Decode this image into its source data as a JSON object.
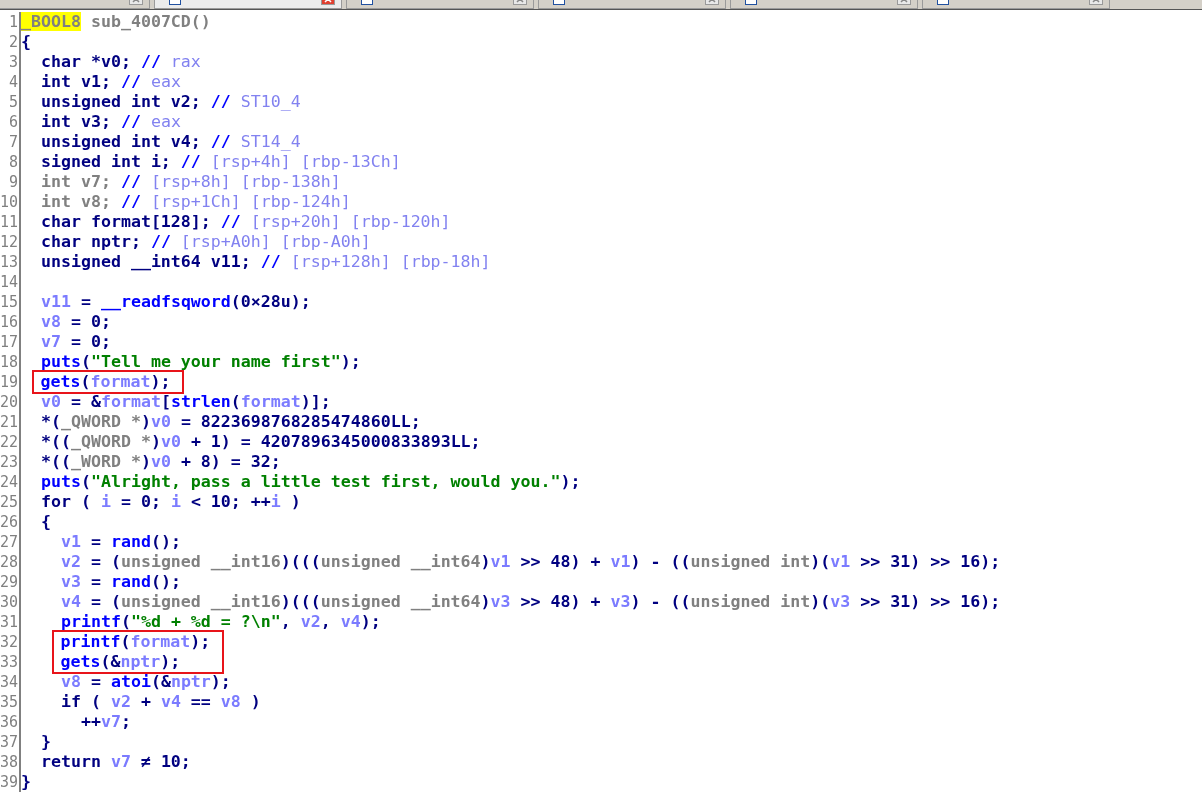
{
  "tabs": [
    {
      "selected": false
    },
    {
      "selected": true
    },
    {
      "selected": false
    },
    {
      "selected": false
    },
    {
      "selected": false
    },
    {
      "selected": false
    }
  ],
  "code": [
    {
      "kind": "line",
      "number": "1",
      "tokens": [
        {
          "kind": "marked",
          "text": "_BOOL8"
        },
        {
          "kind": "muted",
          "text": " sub_4007CD()"
        }
      ]
    },
    {
      "kind": "line",
      "number": "2",
      "tokens": [
        {
          "kind": "plain",
          "text": "{"
        }
      ]
    },
    {
      "kind": "line",
      "number": "3",
      "tokens": [
        {
          "kind": "plain",
          "text": "  char *v0; "
        },
        {
          "kind": "delim",
          "text": "//"
        },
        {
          "kind": "comment",
          "text": " rax"
        }
      ]
    },
    {
      "kind": "line",
      "number": "4",
      "tokens": [
        {
          "kind": "plain",
          "text": "  int v1; "
        },
        {
          "kind": "delim",
          "text": "//"
        },
        {
          "kind": "comment",
          "text": " eax"
        }
      ]
    },
    {
      "kind": "line",
      "number": "5",
      "tokens": [
        {
          "kind": "plain",
          "text": "  unsigned int v2; "
        },
        {
          "kind": "delim",
          "text": "//"
        },
        {
          "kind": "comment",
          "text": " ST10_4"
        }
      ]
    },
    {
      "kind": "line",
      "number": "6",
      "tokens": [
        {
          "kind": "plain",
          "text": "  int v3; "
        },
        {
          "kind": "delim",
          "text": "//"
        },
        {
          "kind": "comment",
          "text": " eax"
        }
      ]
    },
    {
      "kind": "line",
      "number": "7",
      "tokens": [
        {
          "kind": "plain",
          "text": "  unsigned int v4; "
        },
        {
          "kind": "delim",
          "text": "//"
        },
        {
          "kind": "comment",
          "text": " ST14_4"
        }
      ]
    },
    {
      "kind": "line",
      "number": "8",
      "tokens": [
        {
          "kind": "plain",
          "text": "  signed int i; "
        },
        {
          "kind": "delim",
          "text": "//"
        },
        {
          "kind": "comment",
          "text": " [rsp+4h] [rbp-13Ch]"
        }
      ]
    },
    {
      "kind": "line",
      "number": "9",
      "tokens": [
        {
          "kind": "muted",
          "text": "  int v7; "
        },
        {
          "kind": "delim",
          "text": "//"
        },
        {
          "kind": "comment",
          "text": " [rsp+8h] [rbp-138h]"
        }
      ]
    },
    {
      "kind": "line",
      "number": "10",
      "tokens": [
        {
          "kind": "muted",
          "text": "  int v8; "
        },
        {
          "kind": "delim",
          "text": "//"
        },
        {
          "kind": "comment",
          "text": " [rsp+1Ch] [rbp-124h]"
        }
      ]
    },
    {
      "kind": "line",
      "number": "11",
      "tokens": [
        {
          "kind": "plain",
          "text": "  char format[128]; "
        },
        {
          "kind": "delim",
          "text": "//"
        },
        {
          "kind": "comment",
          "text": " [rsp+20h] [rbp-120h]"
        }
      ]
    },
    {
      "kind": "line",
      "number": "12",
      "tokens": [
        {
          "kind": "plain",
          "text": "  char nptr; "
        },
        {
          "kind": "delim",
          "text": "//"
        },
        {
          "kind": "comment",
          "text": " [rsp+A0h] [rbp-A0h]"
        }
      ]
    },
    {
      "kind": "line",
      "number": "13",
      "tokens": [
        {
          "kind": "plain",
          "text": "  unsigned __int64 v11; "
        },
        {
          "kind": "delim",
          "text": "//"
        },
        {
          "kind": "comment",
          "text": " [rsp+128h] [rbp-18h]"
        }
      ]
    },
    {
      "kind": "line",
      "number": "14"
    },
    {
      "kind": "line",
      "number": "15",
      "tokens": [
        {
          "kind": "var",
          "text": "  v11"
        },
        {
          "kind": "plain",
          "text": " = "
        },
        {
          "kind": "call",
          "text": "__readfsqword"
        },
        {
          "kind": "plain",
          "text": "(0×28u);"
        }
      ]
    },
    {
      "kind": "line",
      "number": "16",
      "tokens": [
        {
          "kind": "var",
          "text": "  v8"
        },
        {
          "kind": "plain",
          "text": " = 0;"
        }
      ]
    },
    {
      "kind": "line",
      "number": "17",
      "tokens": [
        {
          "kind": "var",
          "text": "  v7"
        },
        {
          "kind": "plain",
          "text": " = 0;"
        }
      ]
    },
    {
      "kind": "line",
      "number": "18",
      "tokens": [
        {
          "kind": "call",
          "text": "  puts"
        },
        {
          "kind": "plain",
          "text": "("
        },
        {
          "kind": "string",
          "text": "\"Tell me your name first\""
        },
        {
          "kind": "plain",
          "text": ");"
        }
      ]
    },
    {
      "kind": "boxed",
      "lines": [
        {
          "number": "19",
          "tokens": [
            {
              "kind": "call",
              "text": "  gets"
            },
            {
              "kind": "plain",
              "text": "("
            },
            {
              "kind": "var",
              "text": "format"
            },
            {
              "kind": "plain",
              "text": ");"
            }
          ]
        }
      ]
    },
    {
      "kind": "line",
      "number": "20",
      "tokens": [
        {
          "kind": "var",
          "text": "  v0"
        },
        {
          "kind": "plain",
          "text": " = &"
        },
        {
          "kind": "var",
          "text": "format"
        },
        {
          "kind": "plain",
          "text": "["
        },
        {
          "kind": "call",
          "text": "strlen"
        },
        {
          "kind": "plain",
          "text": "("
        },
        {
          "kind": "var",
          "text": "format"
        },
        {
          "kind": "plain",
          "text": ")];"
        }
      ]
    },
    {
      "kind": "line",
      "number": "21",
      "tokens": [
        {
          "kind": "plain",
          "text": "  *("
        },
        {
          "kind": "muted",
          "text": "_QWORD *"
        },
        {
          "kind": "plain",
          "text": ")"
        },
        {
          "kind": "var",
          "text": "v0"
        },
        {
          "kind": "plain",
          "text": " = 8223698768285474860LL;"
        }
      ]
    },
    {
      "kind": "line",
      "number": "22",
      "tokens": [
        {
          "kind": "plain",
          "text": "  *(("
        },
        {
          "kind": "muted",
          "text": "_QWORD *"
        },
        {
          "kind": "plain",
          "text": ")"
        },
        {
          "kind": "var",
          "text": "v0"
        },
        {
          "kind": "plain",
          "text": " + 1) = 4207896345000833893LL;"
        }
      ]
    },
    {
      "kind": "line",
      "number": "23",
      "tokens": [
        {
          "kind": "plain",
          "text": "  *(("
        },
        {
          "kind": "muted",
          "text": "_WORD *"
        },
        {
          "kind": "plain",
          "text": ")"
        },
        {
          "kind": "var",
          "text": "v0"
        },
        {
          "kind": "plain",
          "text": " + 8) = 32;"
        }
      ]
    },
    {
      "kind": "line",
      "number": "24",
      "tokens": [
        {
          "kind": "call",
          "text": "  puts"
        },
        {
          "kind": "plain",
          "text": "("
        },
        {
          "kind": "string",
          "text": "\"Alright, pass a little test first, would you.\""
        },
        {
          "kind": "plain",
          "text": ");"
        }
      ]
    },
    {
      "kind": "line",
      "number": "25",
      "tokens": [
        {
          "kind": "plain",
          "text": "  for ( "
        },
        {
          "kind": "var",
          "text": "i"
        },
        {
          "kind": "plain",
          "text": " = 0; "
        },
        {
          "kind": "var",
          "text": "i"
        },
        {
          "kind": "plain",
          "text": " < 10; ++"
        },
        {
          "kind": "var",
          "text": "i"
        },
        {
          "kind": "plain",
          "text": " )"
        }
      ]
    },
    {
      "kind": "line",
      "number": "26",
      "tokens": [
        {
          "kind": "plain",
          "text": "  {"
        }
      ]
    },
    {
      "kind": "line",
      "number": "27",
      "tokens": [
        {
          "kind": "var",
          "text": "    v1"
        },
        {
          "kind": "plain",
          "text": " = "
        },
        {
          "kind": "call",
          "text": "rand"
        },
        {
          "kind": "plain",
          "text": "();"
        }
      ]
    },
    {
      "kind": "line",
      "number": "28",
      "tokens": [
        {
          "kind": "var",
          "text": "    v2"
        },
        {
          "kind": "plain",
          "text": " = ("
        },
        {
          "kind": "muted",
          "text": "unsigned __int16"
        },
        {
          "kind": "plain",
          "text": ")((("
        },
        {
          "kind": "muted",
          "text": "unsigned __int64"
        },
        {
          "kind": "plain",
          "text": ")"
        },
        {
          "kind": "var",
          "text": "v1"
        },
        {
          "kind": "plain",
          "text": " >> 48) + "
        },
        {
          "kind": "var",
          "text": "v1"
        },
        {
          "kind": "plain",
          "text": ") - (("
        },
        {
          "kind": "muted",
          "text": "unsigned int"
        },
        {
          "kind": "plain",
          "text": ")("
        },
        {
          "kind": "var",
          "text": "v1"
        },
        {
          "kind": "plain",
          "text": " >> 31) >> 16);"
        }
      ]
    },
    {
      "kind": "line",
      "number": "29",
      "tokens": [
        {
          "kind": "var",
          "text": "    v3"
        },
        {
          "kind": "plain",
          "text": " = "
        },
        {
          "kind": "call",
          "text": "rand"
        },
        {
          "kind": "plain",
          "text": "();"
        }
      ]
    },
    {
      "kind": "line",
      "number": "30",
      "tokens": [
        {
          "kind": "var",
          "text": "    v4"
        },
        {
          "kind": "plain",
          "text": " = ("
        },
        {
          "kind": "muted",
          "text": "unsigned __int16"
        },
        {
          "kind": "plain",
          "text": ")((("
        },
        {
          "kind": "muted",
          "text": "unsigned __int64"
        },
        {
          "kind": "plain",
          "text": ")"
        },
        {
          "kind": "var",
          "text": "v3"
        },
        {
          "kind": "plain",
          "text": " >> 48) + "
        },
        {
          "kind": "var",
          "text": "v3"
        },
        {
          "kind": "plain",
          "text": ") - (("
        },
        {
          "kind": "muted",
          "text": "unsigned int"
        },
        {
          "kind": "plain",
          "text": ")("
        },
        {
          "kind": "var",
          "text": "v3"
        },
        {
          "kind": "plain",
          "text": " >> 31) >> 16);"
        }
      ]
    },
    {
      "kind": "line",
      "number": "31",
      "tokens": [
        {
          "kind": "call",
          "text": "    printf"
        },
        {
          "kind": "plain",
          "text": "("
        },
        {
          "kind": "string",
          "text": "\"%d + %d = ?\\n\""
        },
        {
          "kind": "plain",
          "text": ", "
        },
        {
          "kind": "var",
          "text": "v2"
        },
        {
          "kind": "plain",
          "text": ", "
        },
        {
          "kind": "var",
          "text": "v4"
        },
        {
          "kind": "plain",
          "text": ");"
        }
      ]
    },
    {
      "kind": "boxed",
      "lines": [
        {
          "number": "32",
          "tokens": [
            {
              "kind": "call",
              "text": "    printf"
            },
            {
              "kind": "plain",
              "text": "("
            },
            {
              "kind": "var",
              "text": "format"
            },
            {
              "kind": "plain",
              "text": ");"
            }
          ]
        },
        {
          "number": "33",
          "tokens": [
            {
              "kind": "call",
              "text": "    gets"
            },
            {
              "kind": "plain",
              "text": "(&"
            },
            {
              "kind": "var",
              "text": "nptr"
            },
            {
              "kind": "plain",
              "text": ");"
            }
          ]
        }
      ]
    },
    {
      "kind": "line",
      "number": "34",
      "tokens": [
        {
          "kind": "var",
          "text": "    v8"
        },
        {
          "kind": "plain",
          "text": " = "
        },
        {
          "kind": "call",
          "text": "atoi"
        },
        {
          "kind": "plain",
          "text": "(&"
        },
        {
          "kind": "var",
          "text": "nptr"
        },
        {
          "kind": "plain",
          "text": ");"
        }
      ]
    },
    {
      "kind": "line",
      "number": "35",
      "tokens": [
        {
          "kind": "plain",
          "text": "    if ( "
        },
        {
          "kind": "var",
          "text": "v2"
        },
        {
          "kind": "plain",
          "text": " + "
        },
        {
          "kind": "var",
          "text": "v4"
        },
        {
          "kind": "plain",
          "text": " == "
        },
        {
          "kind": "var",
          "text": "v8"
        },
        {
          "kind": "plain",
          "text": " )"
        }
      ]
    },
    {
      "kind": "line",
      "number": "36",
      "tokens": [
        {
          "kind": "plain",
          "text": "      ++"
        },
        {
          "kind": "var",
          "text": "v7"
        },
        {
          "kind": "plain",
          "text": ";"
        }
      ]
    },
    {
      "kind": "line",
      "number": "37",
      "tokens": [
        {
          "kind": "plain",
          "text": "  }"
        }
      ]
    },
    {
      "kind": "line",
      "number": "38",
      "tokens": [
        {
          "kind": "plain",
          "text": "  return "
        },
        {
          "kind": "var",
          "text": "v7"
        },
        {
          "kind": "plain",
          "text": " ≠ 10;"
        }
      ]
    },
    {
      "kind": "line",
      "number": "39",
      "tokens": [
        {
          "kind": "plain",
          "text": "}"
        }
      ]
    }
  ]
}
